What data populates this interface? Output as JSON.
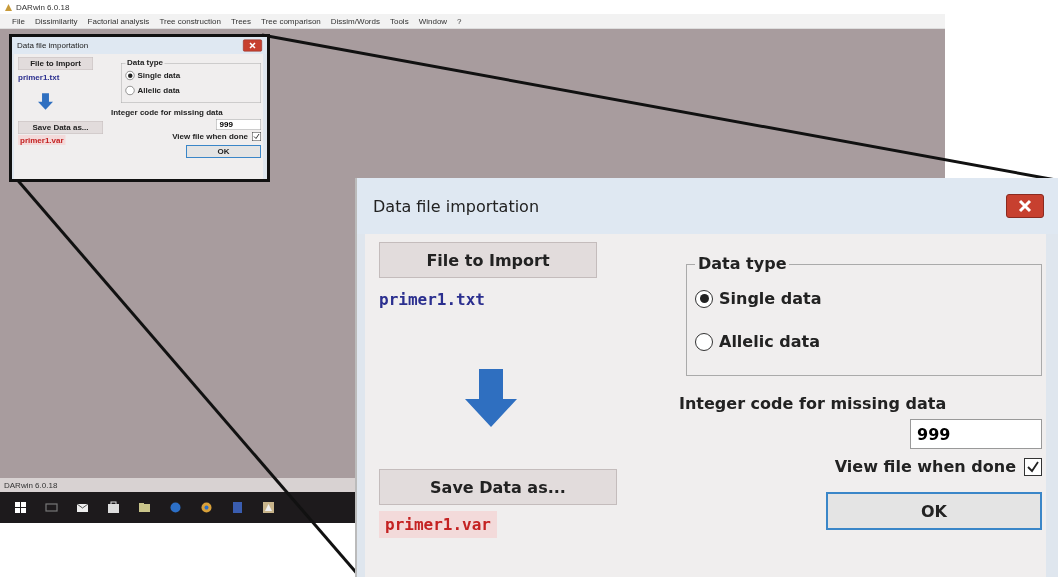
{
  "window": {
    "title": "DARwin 6.0.18"
  },
  "menu": [
    "File",
    "Dissimilarity",
    "Factorial analysis",
    "Tree construction",
    "Trees",
    "Tree comparison",
    "Dissim/Words",
    "Tools",
    "Window",
    "?"
  ],
  "status_bar": "DARwin 6.0.18",
  "dialogs": [
    {
      "title": "Data file importation",
      "file_button": "File to Import",
      "input_file": "primer1.txt",
      "data_type": {
        "legend": "Data type",
        "options": [
          {
            "label": "Single data",
            "selected": true
          },
          {
            "label": "Allelic data",
            "selected": false
          }
        ]
      },
      "missing_label": "Integer code for missing data",
      "missing_value": "999",
      "view_file": {
        "label": "View file when done",
        "checked": true
      },
      "save_button": "Save Data as...",
      "output_file": "primer1.var",
      "ok_button": "OK"
    },
    {
      "title": "Data file importation",
      "file_button": "File to Import",
      "input_file": "primer1.txt",
      "data_type": {
        "legend": "Data type",
        "options": [
          {
            "label": "Single data",
            "selected": true
          },
          {
            "label": "Allelic data",
            "selected": false
          }
        ]
      },
      "missing_label": "Integer code for missing data",
      "missing_value": "999",
      "view_file": {
        "label": "View file when done",
        "checked": true
      },
      "save_button": "Save Data as...",
      "output_file": "primer1.var",
      "ok_button": "OK"
    }
  ]
}
